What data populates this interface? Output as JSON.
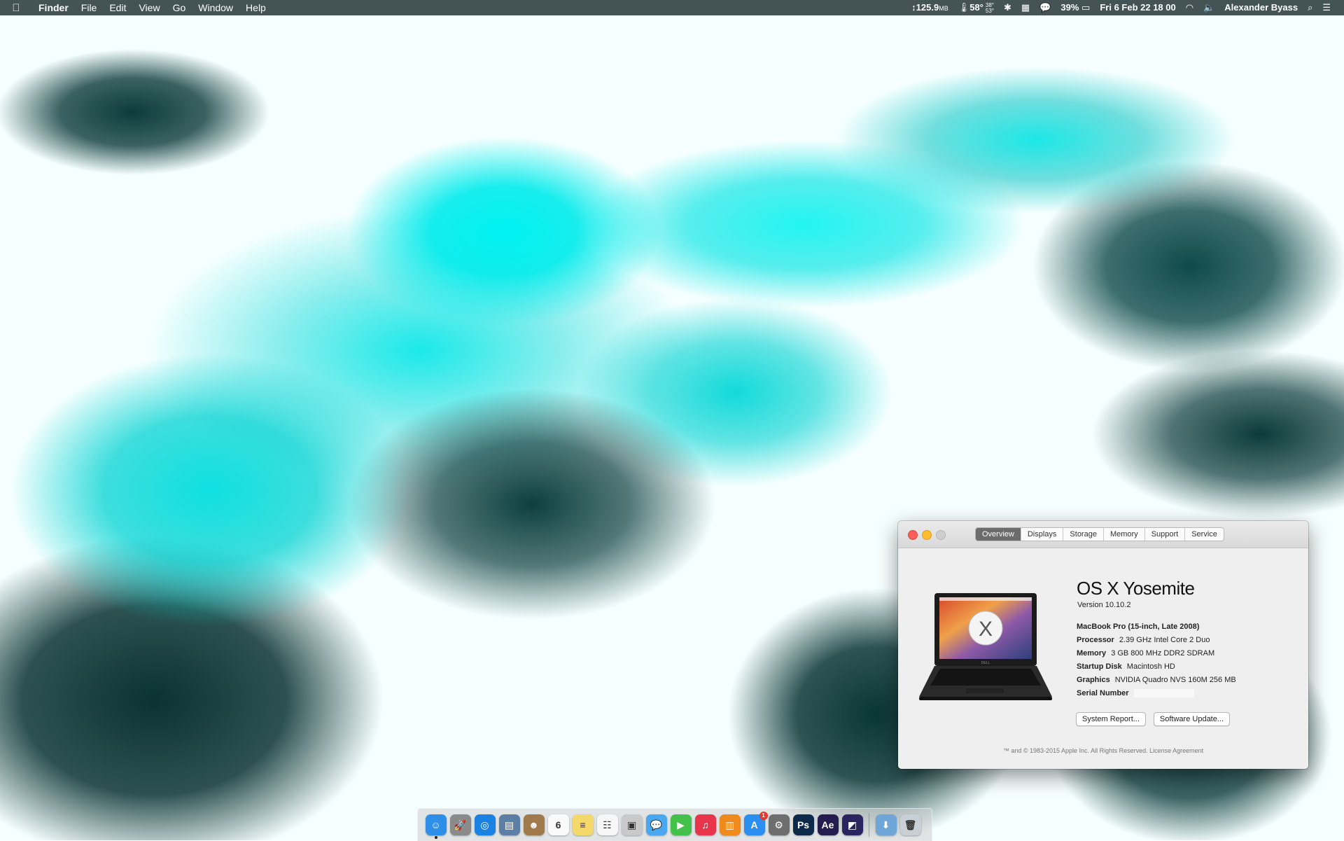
{
  "menubar": {
    "apple_icon": "apple-logo-icon",
    "app_name": "Finder",
    "menus": [
      "File",
      "Edit",
      "View",
      "Go",
      "Window",
      "Help"
    ],
    "status": {
      "memory": "125.9",
      "memory_unit": "MB",
      "temperature": "58°",
      "temp_high": "38°",
      "temp_low": "53°",
      "battery_percent": "39%",
      "datetime": "Fri 6 Feb  22 18 00",
      "user": "Alexander Byass"
    }
  },
  "about_window": {
    "tabs": [
      "Overview",
      "Displays",
      "Storage",
      "Memory",
      "Support",
      "Service"
    ],
    "active_tab": "Overview",
    "os_name_prefix": "OS X",
    "os_name": "Yosemite",
    "version": "Version 10.10.2",
    "model": "MacBook Pro (15-inch, Late 2008)",
    "specs": [
      {
        "label": "Processor",
        "value": "2.39 GHz Intel Core 2 Duo"
      },
      {
        "label": "Memory",
        "value": "3 GB 800 MHz DDR2 SDRAM"
      },
      {
        "label": "Startup Disk",
        "value": "Macintosh HD"
      },
      {
        "label": "Graphics",
        "value": "NVIDIA Quadro NVS 160M 256 MB"
      },
      {
        "label": "Serial Number",
        "value": ""
      }
    ],
    "buttons": [
      "System Report...",
      "Software Update..."
    ],
    "footer": "™ and © 1983-2015 Apple Inc. All Rights Reserved. License Agreement",
    "laptop_brand": "DELL",
    "logo_letter": "X"
  },
  "dock": {
    "icons": [
      {
        "name": "finder",
        "glyph": "☺",
        "color": "#2d8fe8",
        "running": true
      },
      {
        "name": "launchpad",
        "glyph": "🚀",
        "color": "#8a8a8a"
      },
      {
        "name": "safari",
        "glyph": "◎",
        "color": "#1a82e2"
      },
      {
        "name": "preview",
        "glyph": "▤",
        "color": "#5c7fa6"
      },
      {
        "name": "contacts",
        "glyph": "☻",
        "color": "#a07a4a"
      },
      {
        "name": "calendar",
        "glyph": "6",
        "color": "#fafafa"
      },
      {
        "name": "notes",
        "glyph": "≡",
        "color": "#f4d86a"
      },
      {
        "name": "reminders",
        "glyph": "☷",
        "color": "#f7f7f7"
      },
      {
        "name": "photo-booth",
        "glyph": "▣",
        "color": "#c9c9c9"
      },
      {
        "name": "messages",
        "glyph": "💬",
        "color": "#4aa8f0"
      },
      {
        "name": "facetime",
        "glyph": "▶",
        "color": "#43c14a"
      },
      {
        "name": "itunes",
        "glyph": "♫",
        "color": "#e8354b"
      },
      {
        "name": "ibooks",
        "glyph": "▥",
        "color": "#f08a1d"
      },
      {
        "name": "app-store",
        "glyph": "A",
        "color": "#2a8ff0",
        "badge": "1"
      },
      {
        "name": "system-preferences",
        "glyph": "⚙",
        "color": "#6e6e6e"
      },
      {
        "name": "photoshop",
        "glyph": "Ps",
        "color": "#0e2a4a"
      },
      {
        "name": "after-effects",
        "glyph": "Ae",
        "color": "#251d4f"
      },
      {
        "name": "media-encoder",
        "glyph": "◩",
        "color": "#2a2560"
      }
    ],
    "right_icons": [
      {
        "name": "downloads-folder",
        "glyph": "⬇",
        "color": "#6ea6d8"
      },
      {
        "name": "trash",
        "glyph": "🗑",
        "color": "#c8d0d6"
      }
    ]
  }
}
